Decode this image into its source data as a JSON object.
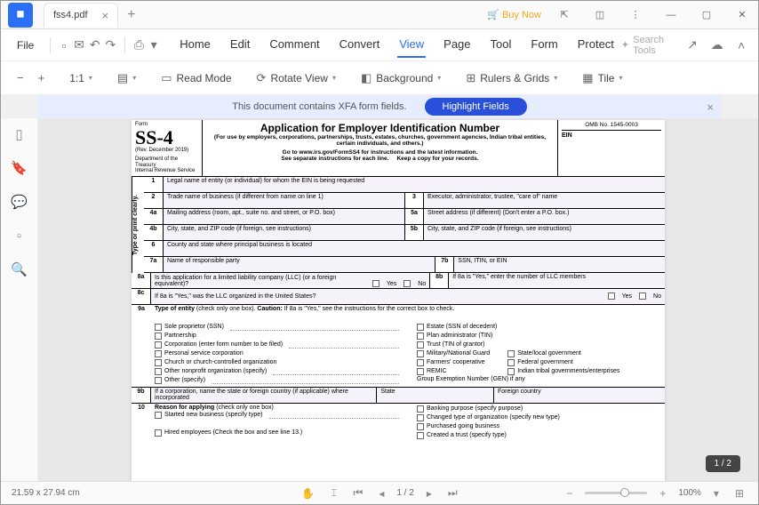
{
  "titlebar": {
    "tab_name": "fss4.pdf",
    "buy_now": "Buy Now"
  },
  "menubar": {
    "file": "File",
    "tabs": [
      "Home",
      "Edit",
      "Comment",
      "Convert",
      "View",
      "Page",
      "Tool",
      "Form",
      "Protect"
    ],
    "active_tab": "View",
    "search_placeholder": "Search Tools"
  },
  "toolbar": {
    "zoom_fit": "1:1",
    "read_mode": "Read Mode",
    "rotate": "Rotate View",
    "background": "Background",
    "rulers": "Rulers & Grids",
    "tile": "Tile"
  },
  "xfa": {
    "msg": "This document contains XFA form fields.",
    "btn": "Highlight Fields"
  },
  "form": {
    "form_no": "SS-4",
    "form_label": "Form",
    "rev": "(Rev. December 2019)",
    "dept": "Department of the Treasury",
    "irs": "Internal Revenue Service",
    "title": "Application for Employer Identification Number",
    "sub": "(For use by employers, corporations, partnerships, trusts, estates, churches, government agencies, Indian tribal entities, certain individuals, and others.)",
    "go": "Go to www.irs.gov/FormSS4 for instructions and the latest information.",
    "see": "See separate instructions for each line.",
    "keep": "Keep a copy for your records.",
    "omb": "OMB No. 1545-0003",
    "ein": "EIN",
    "type_clearly": "Type or print clearly.",
    "r1": "Legal name of entity (or individual) for whom the EIN is being requested",
    "r2": "Trade name of business (if different from name on line 1)",
    "r3": "Executor, administrator, trustee, \"care of\" name",
    "r4a": "Mailing address (room, apt., suite no. and street, or P.O. box)",
    "r5a": "Street address (if different) (Don't enter a P.O. box.)",
    "r4b": "City, state, and ZIP code (if foreign, see instructions)",
    "r5b": "City, state, and ZIP code (if foreign, see instructions)",
    "r6": "County and state where principal business is located",
    "r7a": "Name of responsible party",
    "r7b": "SSN, ITIN, or EIN",
    "r8a": "Is this application for a limited liability company (LLC) (or a foreign equivalent)?",
    "r8b": "If 8a is \"Yes,\" enter the number of LLC members",
    "r8c": "If 8a is \"Yes,\" was the LLC organized in the United States?",
    "yes": "Yes",
    "no": "No",
    "s9a_lead": "Type of entity",
    "s9a_paren": " (check only one box). ",
    "s9a_caution": "Caution:",
    "s9a_tail": " If 8a is \"Yes,\" see the instructions for the correct box to check.",
    "opt_sole": "Sole proprietor (SSN)",
    "opt_partnership": "Partnership",
    "opt_corp": "Corporation (enter form number to be filed)",
    "opt_psc": "Personal service corporation",
    "opt_church": "Church or church-controlled organization",
    "opt_nonprofit": "Other nonprofit organization (specify)",
    "opt_other": "Other (specify)",
    "opt_estate": "Estate (SSN of decedent)",
    "opt_plan": "Plan administrator (TIN)",
    "opt_trust": "Trust (TIN of grantor)",
    "opt_mil": "Military/National Guard",
    "opt_farm": "Farmers' cooperative",
    "opt_remic": "REMIC",
    "opt_slg": "State/local government",
    "opt_fed": "Federal government",
    "opt_tribal": "Indian tribal governments/enterprises",
    "gen": "Group Exemption Number (GEN) if any",
    "s9b": "If a corporation, name the state or foreign country (if applicable) where incorporated",
    "s9b_state": "State",
    "s9b_fc": "Foreign country",
    "s10_lead": "Reason for applying",
    "s10_paren": " (check only one box)",
    "opt_started": "Started new business (specify type)",
    "opt_hired": "Hired employees (Check the box and see line 13.)",
    "opt_banking": "Banking purpose (specify purpose)",
    "opt_changed": "Changed type of organization (specify new type)",
    "opt_purchased": "Purchased going business",
    "opt_created_trust": "Created a trust (specify type)"
  },
  "status": {
    "dims": "21.59 x 27.94 cm",
    "page": "1 / 2",
    "zoom": "100%",
    "indicator": "1 / 2"
  }
}
